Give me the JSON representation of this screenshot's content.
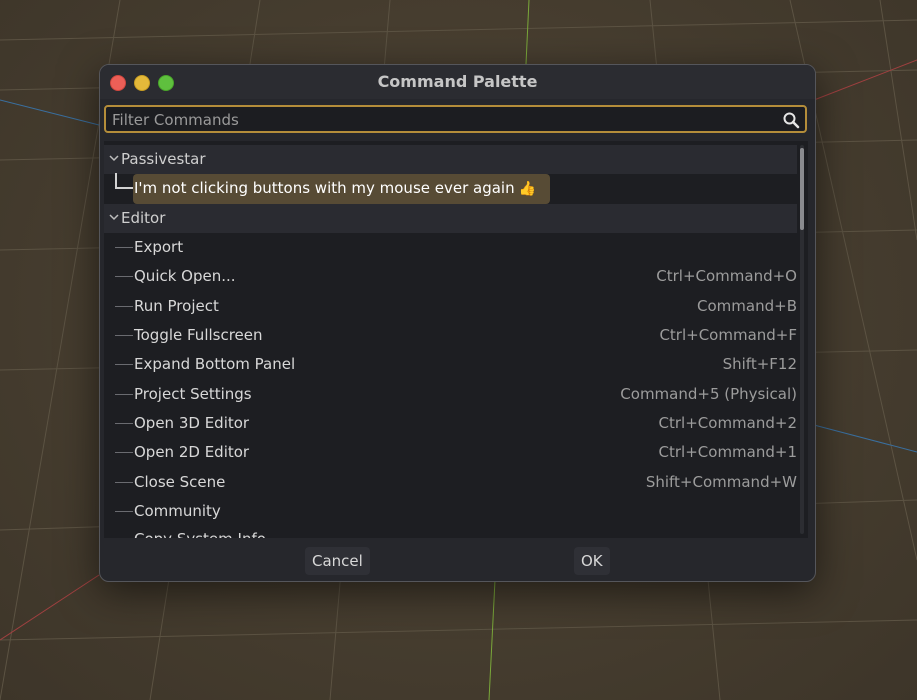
{
  "dialog": {
    "title": "Command Palette",
    "filter_placeholder": "Filter Commands",
    "filter_value": ""
  },
  "tree": {
    "sections": [
      {
        "name": "Passivestar",
        "items": [
          {
            "label": "I'm not clicking buttons with my mouse ever again",
            "emoji": "👍",
            "shortcut": "",
            "selected": true
          }
        ]
      },
      {
        "name": "Editor",
        "items": [
          {
            "label": "Export",
            "shortcut": ""
          },
          {
            "label": "Quick Open...",
            "shortcut": "Ctrl+Command+O"
          },
          {
            "label": "Run Project",
            "shortcut": "Command+B"
          },
          {
            "label": "Toggle Fullscreen",
            "shortcut": "Ctrl+Command+F"
          },
          {
            "label": "Expand Bottom Panel",
            "shortcut": "Shift+F12"
          },
          {
            "label": "Project Settings",
            "shortcut": "Command+5 (Physical)"
          },
          {
            "label": "Open 3D Editor",
            "shortcut": "Ctrl+Command+2"
          },
          {
            "label": "Open 2D Editor",
            "shortcut": "Ctrl+Command+1"
          },
          {
            "label": "Close Scene",
            "shortcut": "Shift+Command+W"
          },
          {
            "label": "Community",
            "shortcut": ""
          },
          {
            "label": "Copy System Info",
            "shortcut": ""
          }
        ]
      }
    ]
  },
  "buttons": {
    "cancel": "Cancel",
    "ok": "OK"
  },
  "colors": {
    "accent_border": "#b48d3a",
    "selection": "#574b35",
    "dialog_bg": "#26272c"
  }
}
